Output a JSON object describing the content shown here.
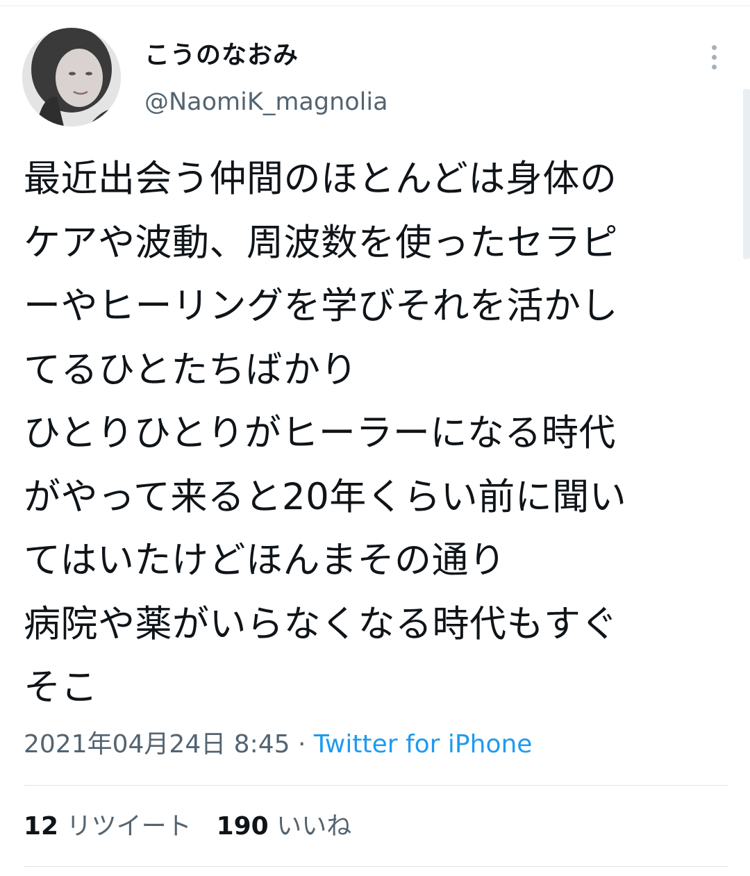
{
  "tweet": {
    "author": {
      "display_name": "こうのなおみ",
      "handle": "@NaomiK_magnolia"
    },
    "text": "最近出会う仲間のほとんどは身体の\nケアや波動、周波数を使ったセラピ\nーやヒーリングを学びそれを活かし\nてるひとたちばかり\nひとりひとりがヒーラーになる時代\nがやって来ると20年くらい前に聞い\nてはいたけどほんまその通り\n病院や薬がいらなくなる時代もすぐ\nそこ",
    "timestamp": "2021年04月24日 8:45",
    "separator": " · ",
    "source": "Twitter for iPhone",
    "stats": {
      "retweets_count": "12",
      "retweets_label": "リツイート",
      "likes_count": "190",
      "likes_label": "いいね"
    }
  },
  "icons": {
    "more": "more-vertical-icon"
  },
  "colors": {
    "text": "#0f1419",
    "secondary": "#536471",
    "link": "#1d9bf0",
    "divider": "#dfe5ea"
  }
}
